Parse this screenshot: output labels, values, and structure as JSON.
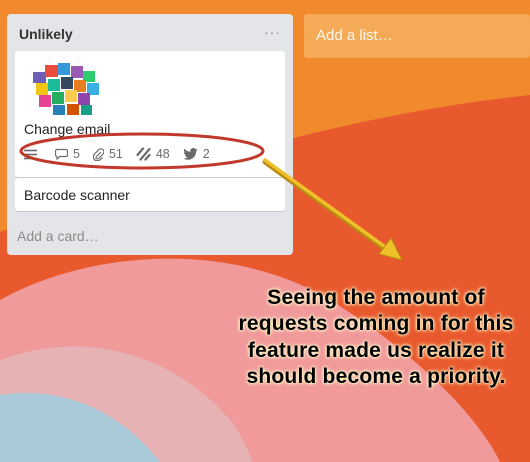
{
  "board": {
    "list": {
      "title": "Unlikely",
      "menu_glyph": "···",
      "add_card_label": "Add a card…",
      "cards": [
        {
          "title": "Change email",
          "badges": {
            "comments": "5",
            "attachments": "51",
            "votes": "48",
            "tweets": "2"
          },
          "icons": [
            "description-icon",
            "comment-icon",
            "paperclip-icon",
            "slash-icon",
            "twitter-bird-icon"
          ]
        },
        {
          "title": "Barcode scanner"
        }
      ]
    },
    "add_list_label": "Add a list…"
  },
  "annotation": {
    "text": "Seeing the amount of requests coming in for this feature made us realize it should become a priority.",
    "text_color": "#000000",
    "glow_color": "#fff6c8",
    "ellipse_color": "#c0392b",
    "arrow_color": "#e8b21e"
  },
  "colors": {
    "background_orange": "#f08a2c",
    "background_red": "#e85a2e",
    "background_pink": "#f19a9c",
    "background_blue": "#a9c8d8",
    "list_bg": "#e4e5e8"
  }
}
